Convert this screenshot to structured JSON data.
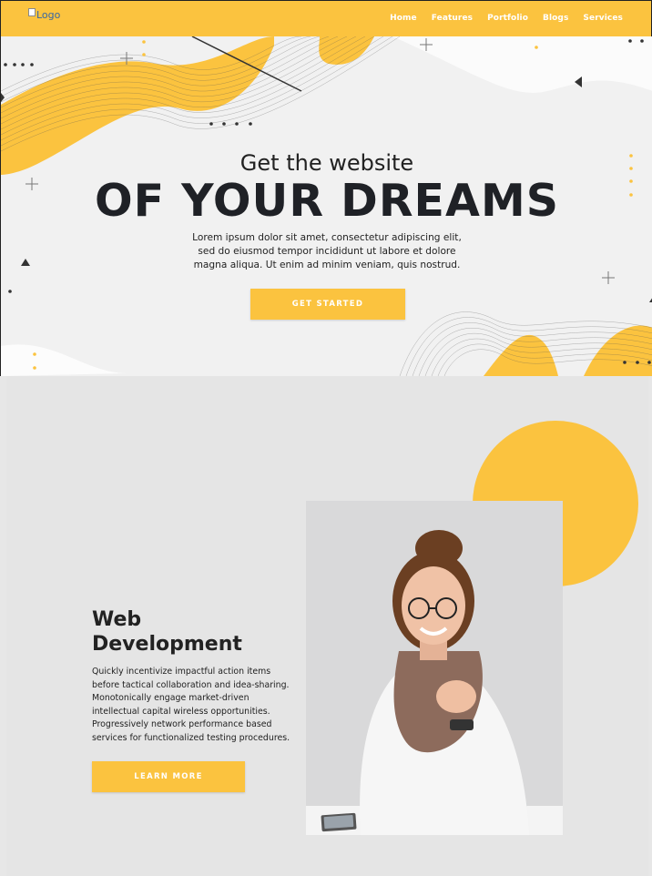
{
  "nav": {
    "logo_alt": "Logo",
    "links": [
      "Home",
      "Features",
      "Portfolio",
      "Blogs",
      "Services"
    ]
  },
  "hero": {
    "subtitle": "Get the website",
    "title": "OF YOUR DREAMS",
    "text": "Lorem ipsum dolor sit amet, consectetur adipiscing elit, sed do eiusmod tempor incididunt ut labore et dolore magna aliqua. Ut enim ad minim veniam, quis nostrud.",
    "cta": "GET STARTED"
  },
  "feature": {
    "title_line1": "Web",
    "title_line2": "Development",
    "text": "Quickly incentivize impactful action items before tactical collaboration and idea-sharing. Monotonically engage market-driven intellectual capital wireless opportunities. Progressively network performance based services for functionalized testing procedures.",
    "cta": "LEARN MORE"
  },
  "colors": {
    "accent": "#fbc33f",
    "dark": "#1f2126",
    "hero_bg": "#f1f1f1",
    "section_bg": "#e5e5e5"
  },
  "icons": [
    "broken-image-icon",
    "plus-icon",
    "triangle-icon",
    "dot-icon"
  ]
}
